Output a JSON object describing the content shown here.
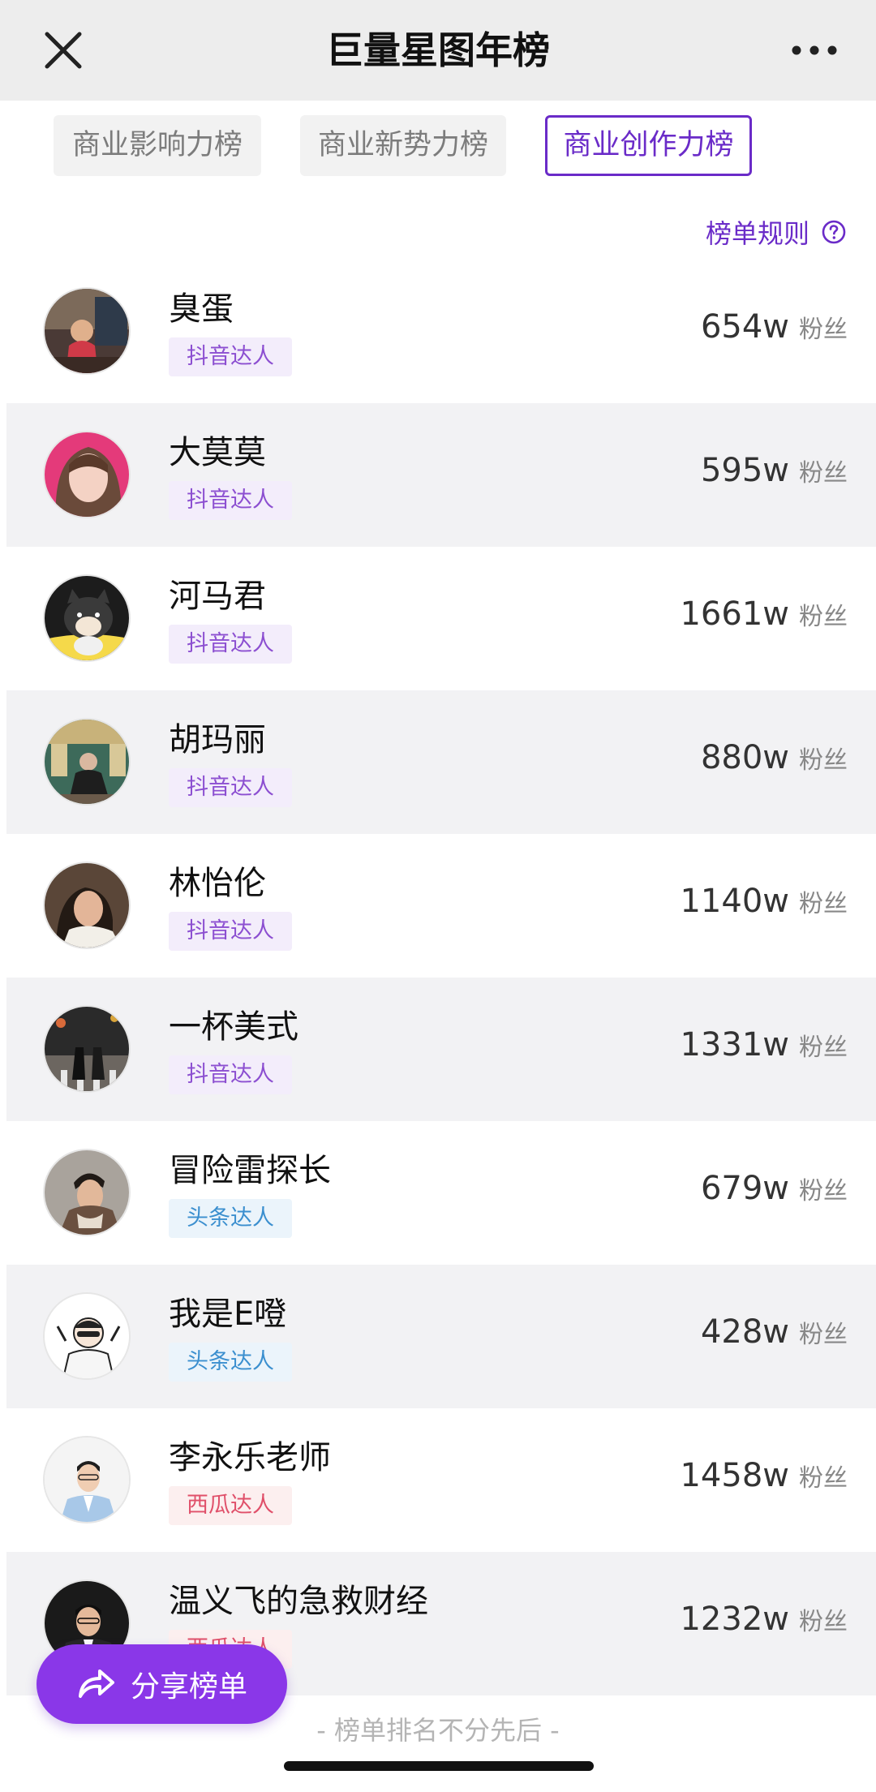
{
  "header": {
    "title": "巨量星图年榜",
    "close_icon": "close-icon",
    "more_icon": "more-dots-icon"
  },
  "tabs": [
    {
      "label": "商业影响力榜",
      "active": false
    },
    {
      "label": "商业新势力榜",
      "active": false
    },
    {
      "label": "商业创作力榜",
      "active": true
    }
  ],
  "rules": {
    "label": "榜单规则",
    "icon": "question-circle-icon"
  },
  "colors": {
    "accent": "#6a2bc8",
    "share_button": "#8a37e8",
    "douyin_badge": "#8c4fd1",
    "toutiao_badge": "#3b8fcf",
    "xigua_badge": "#e0506a"
  },
  "fans_unit": "粉丝",
  "items": [
    {
      "name": "臭蛋",
      "badge": "抖音达人",
      "badge_type": "douyin",
      "fans": "654w"
    },
    {
      "name": "大莫莫",
      "badge": "抖音达人",
      "badge_type": "douyin",
      "fans": "595w"
    },
    {
      "name": "河马君",
      "badge": "抖音达人",
      "badge_type": "douyin",
      "fans": "1661w"
    },
    {
      "name": "胡玛丽",
      "badge": "抖音达人",
      "badge_type": "douyin",
      "fans": "880w"
    },
    {
      "name": "林怡伦",
      "badge": "抖音达人",
      "badge_type": "douyin",
      "fans": "1140w"
    },
    {
      "name": "一杯美式",
      "badge": "抖音达人",
      "badge_type": "douyin",
      "fans": "1331w"
    },
    {
      "name": "冒险雷探长",
      "badge": "头条达人",
      "badge_type": "toutiao",
      "fans": "679w"
    },
    {
      "name": "我是E噔",
      "badge": "头条达人",
      "badge_type": "toutiao",
      "fans": "428w"
    },
    {
      "name": "李永乐老师",
      "badge": "西瓜达人",
      "badge_type": "xigua",
      "fans": "1458w"
    },
    {
      "name": "温义飞的急救财经",
      "badge": "西瓜达人",
      "badge_type": "xigua",
      "fans": "1232w"
    }
  ],
  "share": {
    "label": "分享榜单",
    "icon": "share-icon"
  },
  "footer": {
    "note": "- 榜单排名不分先后 -"
  }
}
